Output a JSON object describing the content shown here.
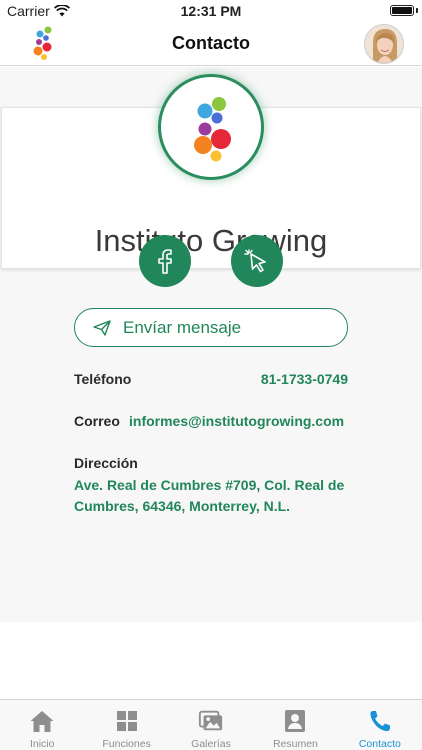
{
  "status_bar": {
    "carrier": "Carrier",
    "time": "12:31 PM"
  },
  "nav": {
    "title": "Contacto"
  },
  "profile": {
    "name": "Instituto Growing"
  },
  "actions": {
    "message_label": "Envíar mensaje"
  },
  "contact": {
    "phone_label": "Teléfono",
    "phone_value": "81-1733-0749",
    "email_label": "Correo",
    "email_value": "informes@institutogrowing.com",
    "address_label": "Dirección",
    "address_value": "Ave. Real de Cumbres #709, Col. Real de Cumbres, 64346, Monterrey, N.L."
  },
  "tabs": [
    {
      "label": "Inicio",
      "icon": "home-icon"
    },
    {
      "label": "Funciones",
      "icon": "grid-icon"
    },
    {
      "label": "Galerías",
      "icon": "gallery-icon"
    },
    {
      "label": "Resumen",
      "icon": "profile-card-icon"
    },
    {
      "label": "Contacto",
      "icon": "phone-icon",
      "active": true
    }
  ],
  "colors": {
    "accent_green": "#21865a",
    "active_tab_blue": "#1a92d6"
  }
}
